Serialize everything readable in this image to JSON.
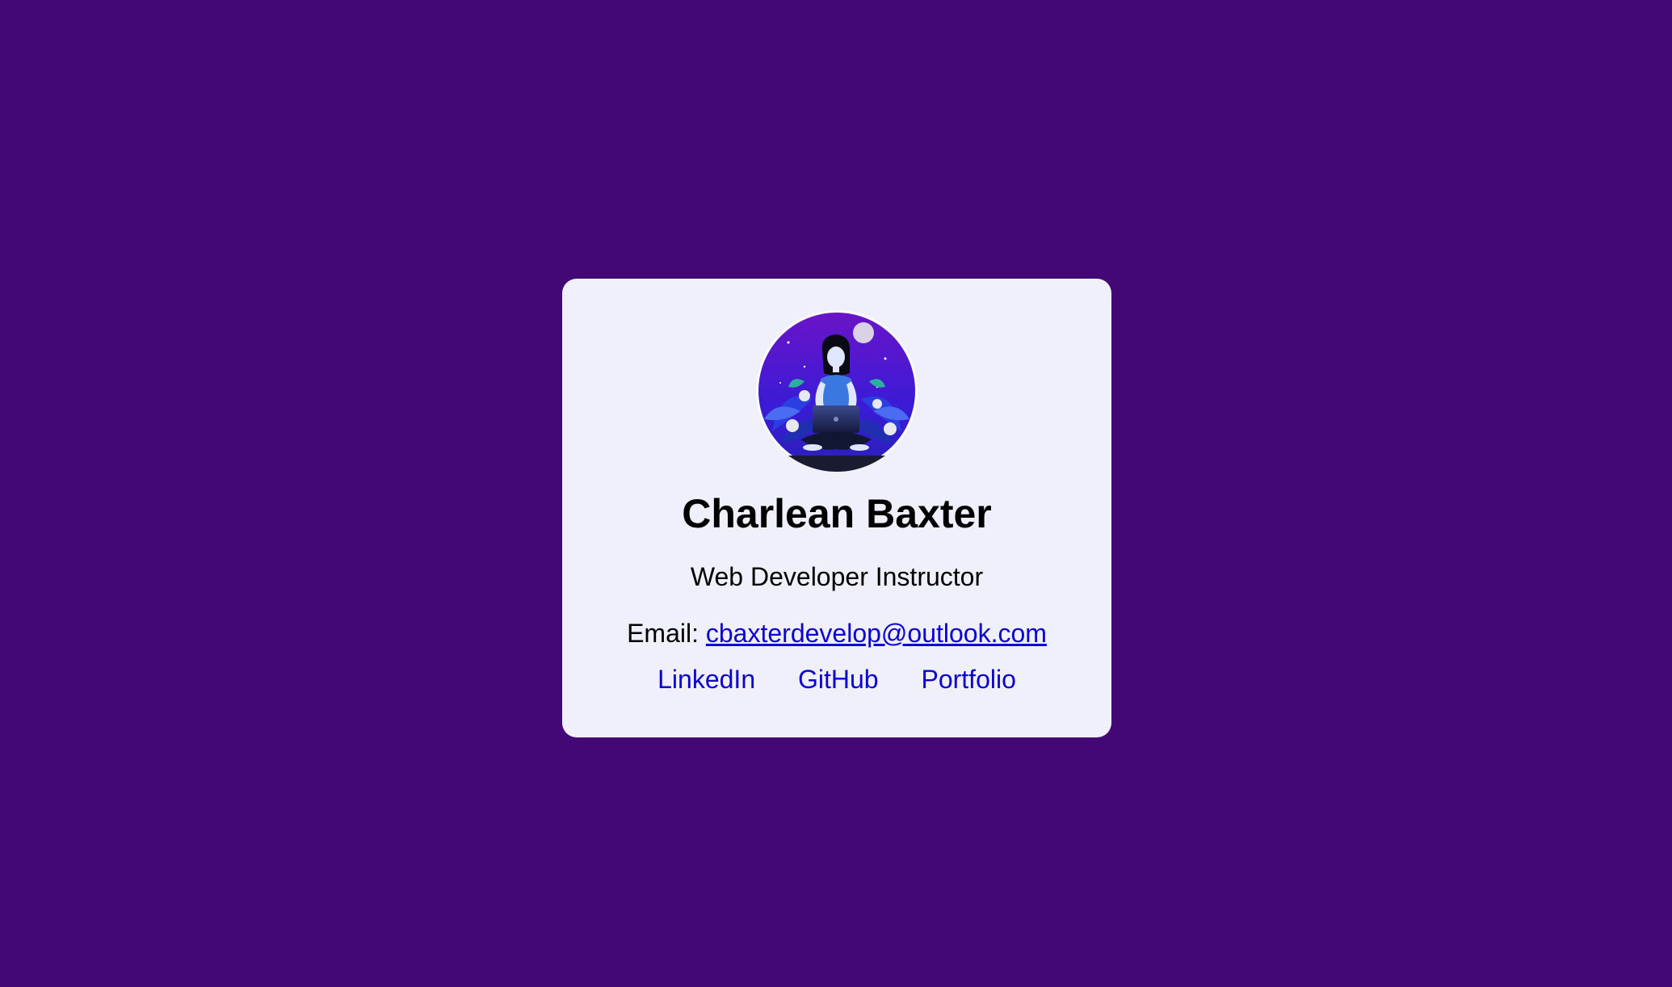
{
  "profile": {
    "name": "Charlean Baxter",
    "role": "Web Developer Instructor",
    "email_label": "Email:",
    "email": "cbaxterdevelop@outlook.com",
    "avatar_icon": "meditating-developer-illustration"
  },
  "links": [
    {
      "label": "LinkedIn"
    },
    {
      "label": "GitHub"
    },
    {
      "label": "Portfolio"
    }
  ],
  "colors": {
    "background": "#430876",
    "card": "#eff0fb",
    "link": "#0b00cf",
    "text": "#000000"
  }
}
